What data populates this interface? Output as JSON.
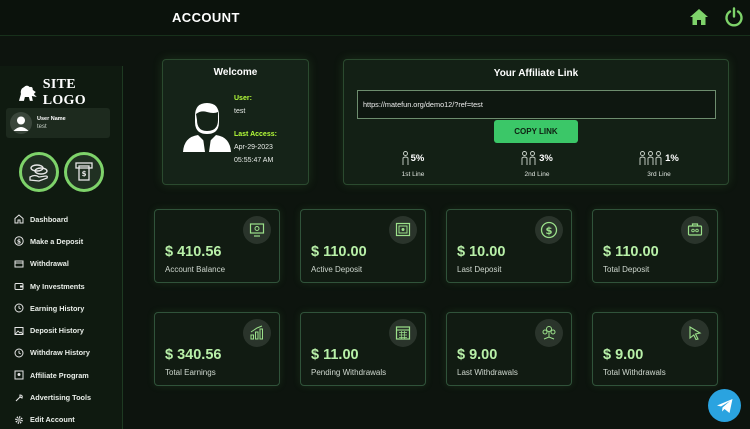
{
  "header": {
    "title": "ACCOUNT",
    "home_icon": "home-icon",
    "power_icon": "power-icon",
    "icon_color": "#7ed36a"
  },
  "sidebar": {
    "logo_text": "SITE LOGO",
    "user": {
      "name_label": "User Name",
      "name": "test"
    },
    "items": [
      {
        "label": "Dashboard",
        "icon": "dashboard-icon"
      },
      {
        "label": "Make a Deposit",
        "icon": "dollar-circle-icon"
      },
      {
        "label": "Withdrawal",
        "icon": "withdrawal-icon"
      },
      {
        "label": "My Investments",
        "icon": "wallet-icon"
      },
      {
        "label": "Earning History",
        "icon": "history-icon"
      },
      {
        "label": "Deposit History",
        "icon": "image-icon"
      },
      {
        "label": "Withdraw History",
        "icon": "history-icon"
      },
      {
        "label": "Affiliate Program",
        "icon": "affiliate-icon"
      },
      {
        "label": "Advertising Tools",
        "icon": "tools-icon"
      },
      {
        "label": "Edit Account",
        "icon": "gear-icon"
      }
    ]
  },
  "welcome": {
    "heading": "Welcome",
    "user_label": "User:",
    "user_value": "test",
    "access_label": "Last Access:",
    "access_date": "Apr-29-2023",
    "access_time": "05:55:47 AM"
  },
  "affiliate": {
    "heading": "Your Affiliate Link",
    "link": "https://matefun.org/demo12/?ref=test",
    "copy_label": "COPY LINK",
    "levels": [
      {
        "pct": "5%",
        "label": "1st Line"
      },
      {
        "pct": "3%",
        "label": "2nd Line"
      },
      {
        "pct": "1%",
        "label": "3rd Line"
      }
    ]
  },
  "stats": [
    {
      "amount": "$ 410.56",
      "label": "Account Balance",
      "icon": "monitor-icon"
    },
    {
      "amount": "$ 110.00",
      "label": "Active Deposit",
      "icon": "safe-icon"
    },
    {
      "amount": "$ 10.00",
      "label": "Last Deposit",
      "icon": "dollar-circle-icon"
    },
    {
      "amount": "$ 110.00",
      "label": "Total Deposit",
      "icon": "briefcase-icon"
    },
    {
      "amount": "$ 340.56",
      "label": "Total Earnings",
      "icon": "chart-growth-icon"
    },
    {
      "amount": "$ 11.00",
      "label": "Pending Withdrawals",
      "icon": "calendar-icon"
    },
    {
      "amount": "$ 9.00",
      "label": "Last Withdrawals",
      "icon": "money-tree-icon"
    },
    {
      "amount": "$ 9.00",
      "label": "Total Withdrawals",
      "icon": "cursor-icon"
    }
  ],
  "colors": {
    "accent": "#7ed36a",
    "label_green": "#b6ff3a",
    "button": "#3bc768",
    "telegram": "#2aa3e0"
  }
}
